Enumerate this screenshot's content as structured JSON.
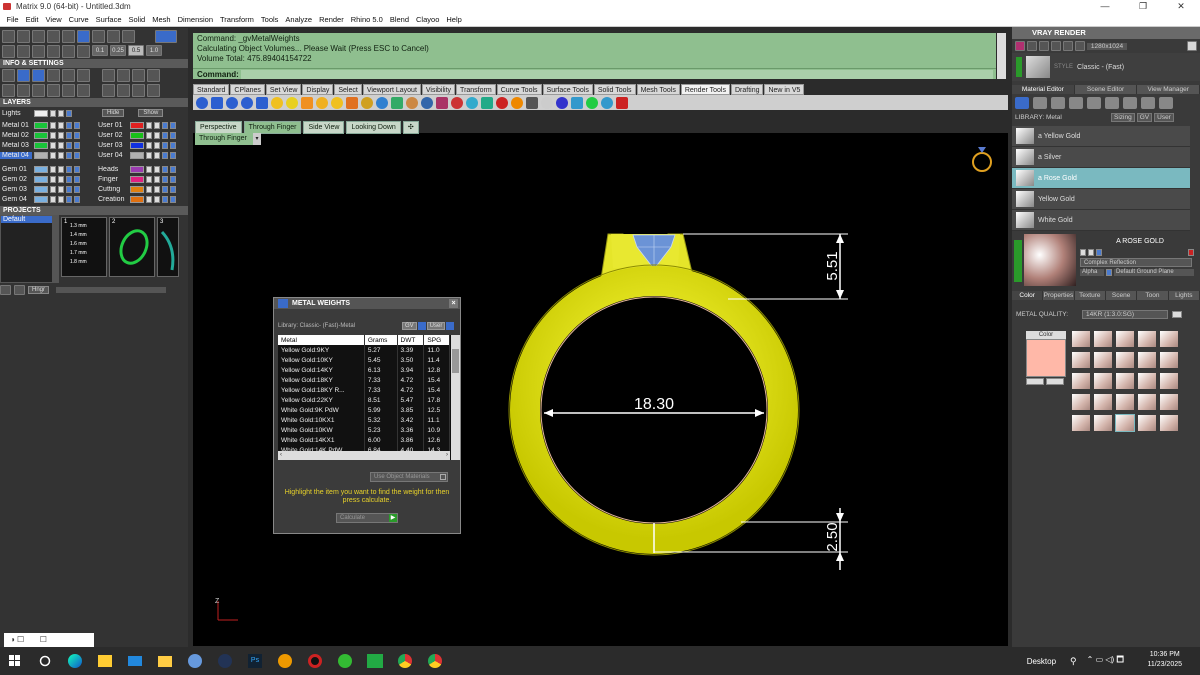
{
  "window": {
    "title": "Matrix 9.0 (64-bit) - Untitled.3dm",
    "buttons": [
      "—",
      "❐",
      "✕"
    ]
  },
  "menu": [
    "File",
    "Edit",
    "View",
    "Curve",
    "Surface",
    "Solid",
    "Mesh",
    "Dimension",
    "Transform",
    "Tools",
    "Analyze",
    "Render",
    "Rhino 5.0",
    "Blend",
    "Clayoo",
    "Help"
  ],
  "left": {
    "info_title": "INFO & SETTINGS",
    "toolbar_nums": [
      "0.1",
      "0.25",
      "0.5",
      "1.0"
    ],
    "layers_title": "LAYERS",
    "lights": "Lights",
    "hide": "Hide",
    "show": "Show",
    "layers_left": [
      {
        "n": "Metal 01",
        "c": "#19c43a"
      },
      {
        "n": "Metal 02",
        "c": "#19c43a"
      },
      {
        "n": "Metal 03",
        "c": "#19c43a"
      },
      {
        "n": "Metal 04",
        "c": "#b0b0b0"
      }
    ],
    "layers_right": [
      {
        "n": "User 01",
        "c": "#e02020"
      },
      {
        "n": "User 02",
        "c": "#18c018"
      },
      {
        "n": "User 03",
        "c": "#1030e0"
      },
      {
        "n": "User 04",
        "c": "#b0b0b0"
      }
    ],
    "gems": [
      {
        "n": "Gem 01",
        "c": "#7ab0e0"
      },
      {
        "n": "Gem 02",
        "c": "#7ab0e0"
      },
      {
        "n": "Gem 03",
        "c": "#7ab0e0"
      },
      {
        "n": "Gem 04",
        "c": "#7ab0e0"
      }
    ],
    "gems_right": [
      {
        "n": "Heads",
        "c": "#9a3bb0"
      },
      {
        "n": "Finger",
        "c": "#e02080"
      },
      {
        "n": "Cutting",
        "c": "#e08010"
      },
      {
        "n": "Creation",
        "c": "#e07010"
      }
    ],
    "projects_title": "PROJECTS",
    "project_item": "Default",
    "thumb_labels": [
      "1",
      "2",
      "3"
    ],
    "thumb_sizes": [
      "1.3 mm",
      "1.4 mm",
      "1.6 mm",
      "1.7 mm",
      "1.8 mm"
    ],
    "hinge": "Hngr"
  },
  "command": {
    "lines": [
      "Command: _gvMetalWeights",
      "Calculating Object Volumes... Please Wait (Press ESC to Cancel)",
      "Volume Total: 475.89404154722"
    ],
    "prompt": "Command:"
  },
  "tabs": [
    "Standard",
    "CPlanes",
    "Set View",
    "Display",
    "Select",
    "Viewport Layout",
    "Visibility",
    "Transform",
    "Curve Tools",
    "Surface Tools",
    "Solid Tools",
    "Mesh Tools",
    "Render Tools",
    "Drafting",
    "New in V5"
  ],
  "active_tab": "Render Tools",
  "viewtabs": [
    "Perspective",
    "Through Finger",
    "Side View",
    "Looking Down",
    "✣"
  ],
  "viewport_name": "Through Finger",
  "dims": {
    "top": "5.51",
    "diameter": "18.30",
    "bottom": "2.50"
  },
  "axis_label": "Z",
  "metal_weights": {
    "title": "METAL WEIGHTS",
    "library_label": "Library: Classic- (Fast)-Metal",
    "gv": "GV",
    "user": "User",
    "columns": [
      "Metal",
      "Grams",
      "DWT",
      "SPG"
    ],
    "rows": [
      [
        "Yellow Gold:9KY",
        "5.27",
        "3.39",
        "11.0"
      ],
      [
        "Yellow Gold:10KY",
        "5.45",
        "3.50",
        "11.4"
      ],
      [
        "Yellow Gold:14KY",
        "6.13",
        "3.94",
        "12.8"
      ],
      [
        "Yellow Gold:18KY",
        "7.33",
        "4.72",
        "15.4"
      ],
      [
        "Yellow Gold:18KY R...",
        "7.33",
        "4.72",
        "15.4"
      ],
      [
        "Yellow Gold:22KY",
        "8.51",
        "5.47",
        "17.8"
      ],
      [
        "White Gold:9K PdW",
        "5.99",
        "3.85",
        "12.5"
      ],
      [
        "White Gold:10KX1",
        "5.32",
        "3.42",
        "11.1"
      ],
      [
        "White Gold:10KW",
        "5.23",
        "3.36",
        "10.9"
      ],
      [
        "White Gold:14KX1",
        "6.00",
        "3.86",
        "12.6"
      ],
      [
        "White Gold:14K PdW",
        "6.84",
        "4.40",
        "14.3"
      ]
    ],
    "use_object": "Use Object Materials",
    "hint": "Highlight the item you want to find the weight for then press calculate.",
    "calc": "Calculate"
  },
  "right": {
    "title": "VRAY RENDER",
    "resolution": "1280x1024",
    "style_label": "STYLE",
    "style_value": "Classic - (Fast)",
    "tabs": [
      "Material Editor",
      "Scene Editor",
      "View Manager"
    ],
    "library_label": "LIBRARY: Metal",
    "library_opts": [
      "Sizing",
      "GV",
      "User"
    ],
    "items": [
      "a Yellow Gold",
      "a Silver",
      "a Rose Gold",
      "Yellow Gold",
      "White Gold"
    ],
    "selected_index": 2,
    "preview_name": "A ROSE GOLD",
    "reflection": "Complex Reflection",
    "alpha": "Alpha",
    "ground": "Default Ground Plane",
    "subtabs": [
      "Color",
      "Properties",
      "Texture",
      "Scene",
      "Toon",
      "Lights"
    ],
    "quality_label": "METAL QUALITY:",
    "quality_value": "14KR (1:3.0:SG)",
    "color_label": "Color",
    "swatch": "#ffb8a8"
  },
  "taskbar": {
    "desktop": "Desktop",
    "time": "10:36 PM",
    "date": "11/23/2025"
  }
}
